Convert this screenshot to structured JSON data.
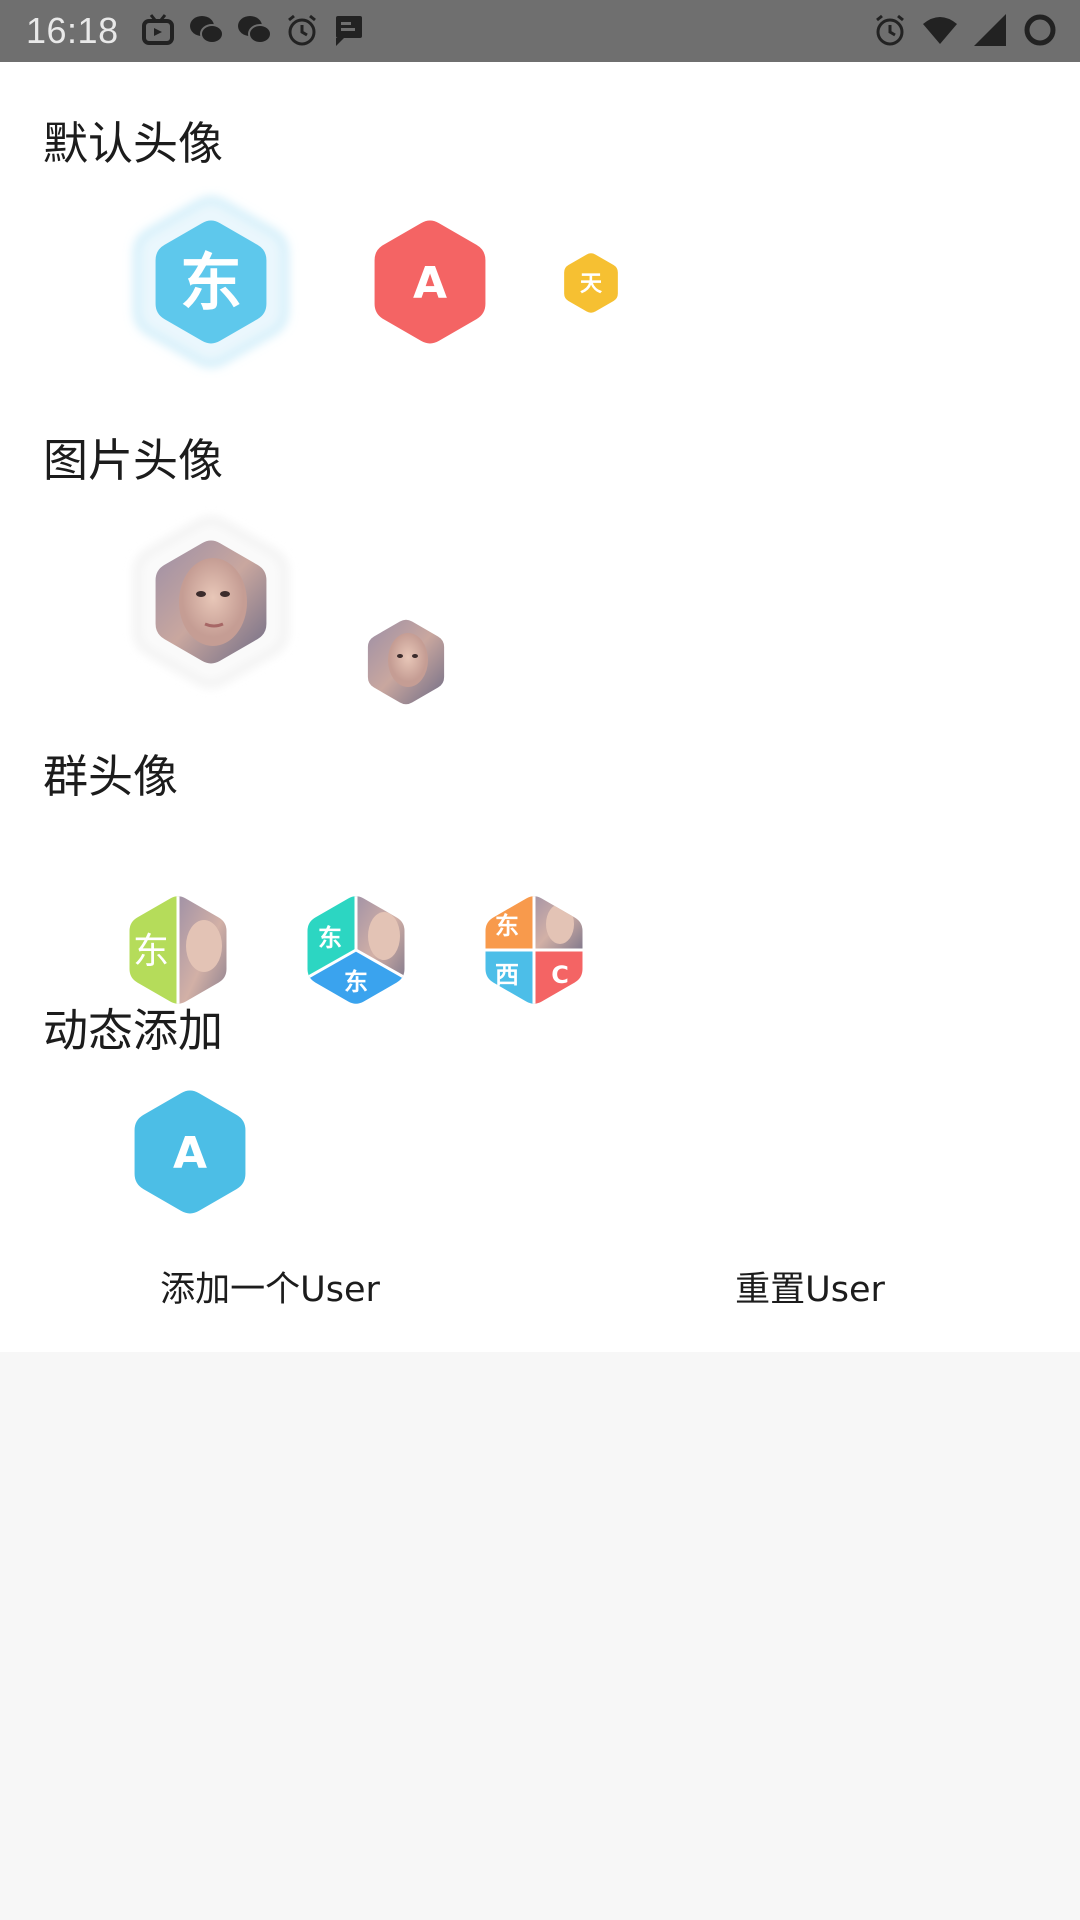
{
  "status_bar": {
    "time": "16:18",
    "left_icons": [
      "bilibili-tv-icon",
      "wechat-icon",
      "wechat-icon",
      "alarm-icon",
      "message-icon"
    ],
    "right_icons": [
      "alarm-icon",
      "wifi-icon",
      "signal-icon",
      "loading-ring-icon"
    ]
  },
  "sections": {
    "default_avatar": {
      "title": "默认头像"
    },
    "image_avatar": {
      "title": "图片头像"
    },
    "group_avatar": {
      "title": "群头像"
    },
    "dynamic_add": {
      "title": "动态添加"
    }
  },
  "default_avatars": [
    {
      "text": "东",
      "color": "#5ec8ec",
      "glow": true
    },
    {
      "text": "A",
      "color": "#f46464"
    },
    {
      "text": "天",
      "color": "#f6c032"
    }
  ],
  "group_avatars": {
    "two": [
      "东"
    ],
    "three": [
      "东",
      "东"
    ],
    "four": [
      "东",
      "西",
      "C"
    ]
  },
  "group_colors": {
    "green": "#b5dc5a",
    "teal": "#2cd6c2",
    "blue": "#3aa3ee",
    "orange": "#f89a4c",
    "sky": "#4cbee8",
    "red": "#f46464"
  },
  "dynamic_avatar": {
    "text": "A",
    "color": "#4cbee6"
  },
  "buttons": {
    "add_user": "添加一个User",
    "reset_user": "重置User"
  }
}
